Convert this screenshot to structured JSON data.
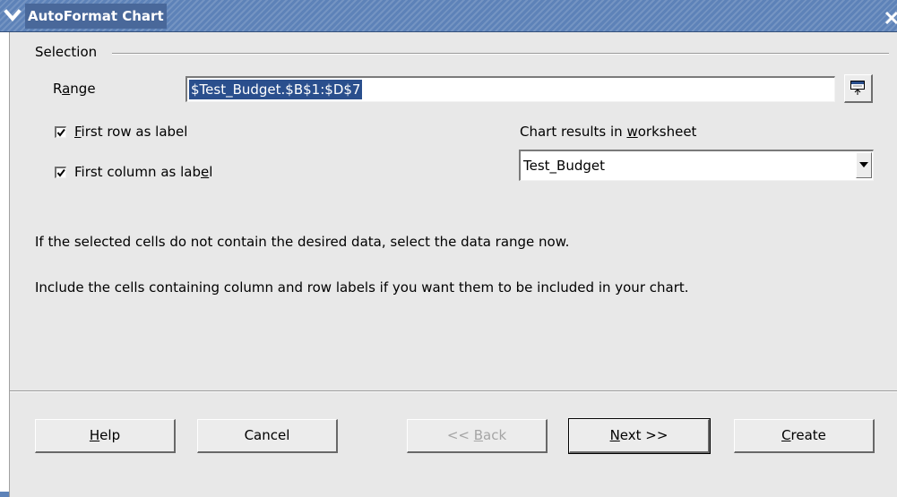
{
  "window": {
    "title": "AutoFormat Chart",
    "menu_icon": "chevron-down-icon",
    "close_icon": "close-icon"
  },
  "selection": {
    "frame_label": "Selection",
    "range": {
      "label_pre": "R",
      "label_accel": "a",
      "label_post": "nge",
      "value": "$Test_Budget.$B$1:$D$7",
      "shrink_icon": "shrink-dialog-icon"
    },
    "first_row": {
      "checked": true,
      "accel": "F",
      "label_rest": "irst row as label"
    },
    "first_column": {
      "checked": true,
      "label_pre": "First column as lab",
      "accel": "e",
      "label_post": "l"
    },
    "chart_results": {
      "label_pre": "Chart results in ",
      "accel": "w",
      "label_post": "orksheet",
      "selected": "Test_Budget"
    }
  },
  "info": {
    "line1": "If the selected cells do not contain the desired data, select the data range now.",
    "line2": "Include the cells containing column and row labels if you want them to be included in your chart."
  },
  "buttons": {
    "help": {
      "accel": "H",
      "rest": "elp"
    },
    "cancel": {
      "label": "Cancel"
    },
    "back": {
      "pre": "<< ",
      "accel": "B",
      "rest": "ack",
      "enabled": false
    },
    "next": {
      "accel": "N",
      "rest": "ext >>"
    },
    "create": {
      "accel": "C",
      "rest": "reate"
    }
  },
  "colors": {
    "titlebar": "#5d82b8",
    "dialog_bg": "#e8e8e8",
    "selection_highlight": "#2a4f8d"
  }
}
